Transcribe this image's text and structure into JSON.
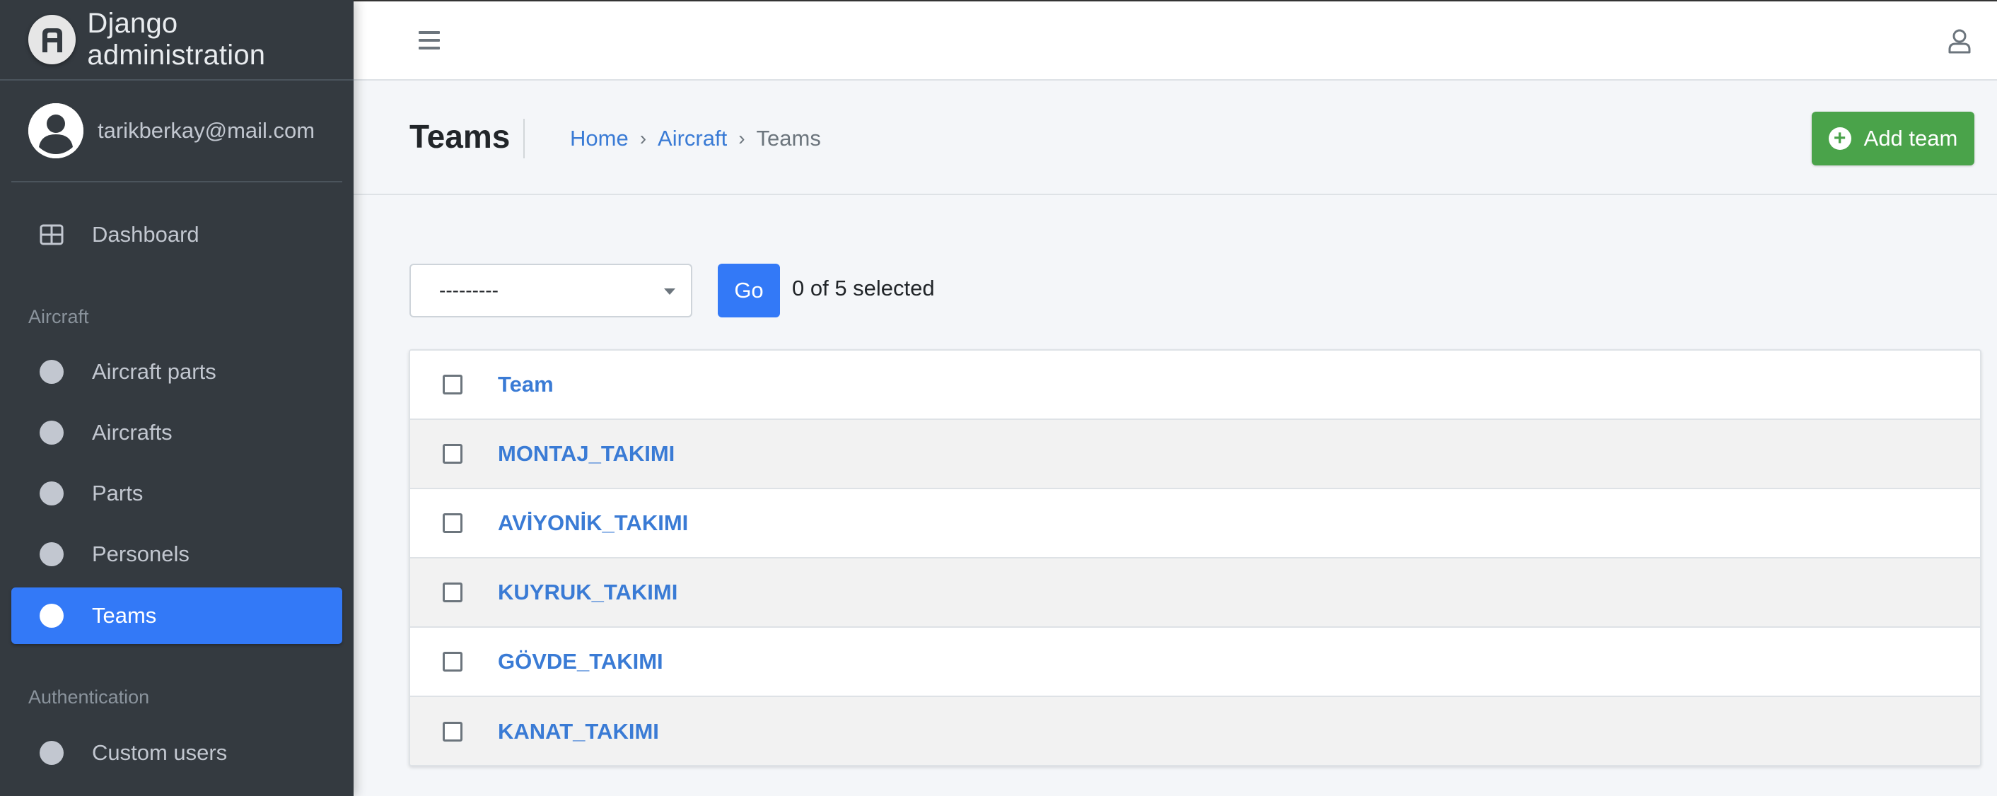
{
  "brand": {
    "title": "Django administration"
  },
  "user": {
    "email": "tarikberkay@mail.com"
  },
  "sidebar": {
    "dashboard_label": "Dashboard",
    "sections": [
      {
        "header": "Aircraft",
        "items": [
          {
            "label": "Aircraft parts",
            "icon": "circle-icon"
          },
          {
            "label": "Aircrafts",
            "icon": "circle-icon"
          },
          {
            "label": "Parts",
            "icon": "circle-icon"
          },
          {
            "label": "Personels",
            "icon": "circle-icon"
          },
          {
            "label": "Teams",
            "icon": "circle-icon",
            "active": true
          }
        ]
      },
      {
        "header": "Authentication",
        "items": [
          {
            "label": "Custom users",
            "icon": "circle-icon"
          }
        ]
      }
    ]
  },
  "header": {
    "title": "Teams",
    "breadcrumb": {
      "home": "Home",
      "sep1": "›",
      "app": "Aircraft",
      "sep2": "›",
      "current": "Teams"
    },
    "add_button": "Add team"
  },
  "actions": {
    "select_value": "---------",
    "go_label": "Go",
    "selected_text": "0 of 5 selected"
  },
  "table": {
    "column_header": "Team",
    "rows": [
      "MONTAJ_TAKIMI",
      "AVİYONİK_TAKIMI",
      "KUYRUK_TAKIMI",
      "GÖVDE_TAKIMI",
      "KANAT_TAKIMI"
    ]
  },
  "colors": {
    "sidebar_bg": "#343a40",
    "accent": "#3379f7",
    "success": "#4aa34a",
    "link": "#3a7bd5"
  }
}
